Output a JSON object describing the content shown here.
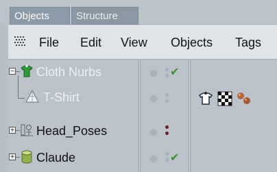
{
  "tabs": [
    {
      "label": "Objects",
      "active": true
    },
    {
      "label": "Structure",
      "active": false
    }
  ],
  "menu": {
    "icon": "grid-icon",
    "items": [
      "File",
      "Edit",
      "View",
      "Objects",
      "Tags"
    ]
  },
  "tree": {
    "rows": [
      {
        "name": "Cloth Nurbs",
        "icon": "cloth-nurbs-icon",
        "expander": "−",
        "status": [
          "gray",
          "check"
        ],
        "highlighted": false
      },
      {
        "name": "T-Shirt",
        "icon": "polygon-object-icon",
        "expander": "",
        "status": [
          "gray",
          "gray"
        ],
        "highlighted": false
      },
      {
        "name": "Head_Poses",
        "icon": "null-object-icon",
        "expander": "+",
        "status": [
          "maroon",
          "maroon"
        ],
        "highlighted": false
      },
      {
        "name": "Claude",
        "icon": "cylinder-object-icon",
        "expander": "+",
        "status": [
          "gray",
          "check"
        ],
        "highlighted": false
      }
    ]
  },
  "tags": {
    "row_index": 1,
    "items": [
      "cloth-tag-icon",
      "checker-texture-tag-icon",
      "material-tag-icon"
    ]
  },
  "colors": {
    "accent_check": "#3d8f2e",
    "dot_gray": "#a9b0b8",
    "dot_maroon": "#6b1f1f"
  }
}
